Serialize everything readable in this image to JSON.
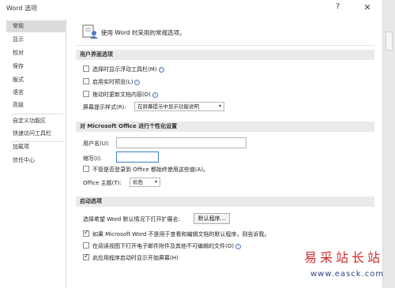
{
  "window": {
    "title": "Word 选项",
    "help": "?",
    "close": "✕"
  },
  "sidebar": {
    "items": [
      {
        "label": "常规"
      },
      {
        "label": "显示"
      },
      {
        "label": "校对"
      },
      {
        "label": "保存"
      },
      {
        "label": "版式"
      },
      {
        "label": "语言"
      },
      {
        "label": "高级"
      },
      {
        "label": "自定义功能区"
      },
      {
        "label": "快速访问工具栏"
      },
      {
        "label": "加载项"
      },
      {
        "label": "信任中心"
      }
    ]
  },
  "main": {
    "header": "使用 Word 时采用的常规选项。",
    "ui_section": {
      "title": "用户界面选项",
      "options": [
        {
          "label": "选择时显示浮动工具栏(M)",
          "checked": false
        },
        {
          "label": "启用实时预览(L)",
          "checked": false
        },
        {
          "label": "拖动时更新文档内容(D)",
          "checked": false
        }
      ],
      "tooltip_label": "屏幕提示样式(R):",
      "tooltip_value": "在屏幕提示中显示功能说明"
    },
    "personal_section": {
      "title": "对 Microsoft Office 进行个性化设置",
      "username_label": "用户名(U):",
      "username_value": "",
      "initials_label": "缩写(I):",
      "initials_value": "",
      "always_use_label": "不管是否登录到 Office 都始终使用这些值(A)。",
      "theme_label": "Office 主题(T):",
      "theme_value": "彩色"
    },
    "startup_section": {
      "title": "启动选项",
      "default_programs_label": "选择希望 Word 默认情况下打开扩展名:",
      "default_programs_button": "默认程序...",
      "options": [
        {
          "label": "如果 Microsoft Word 不是用于查看和编辑文档的默认程序，则告诉我。",
          "checked": true
        },
        {
          "label": "在阅读视图下打开电子邮件附件及其他不可编辑的文件(O)",
          "checked": false
        },
        {
          "label": "此应用程序启动时显示开始屏幕(H)",
          "checked": true
        }
      ]
    }
  },
  "watermark": {
    "title": "易采站长站",
    "url": "www.easck.com"
  }
}
